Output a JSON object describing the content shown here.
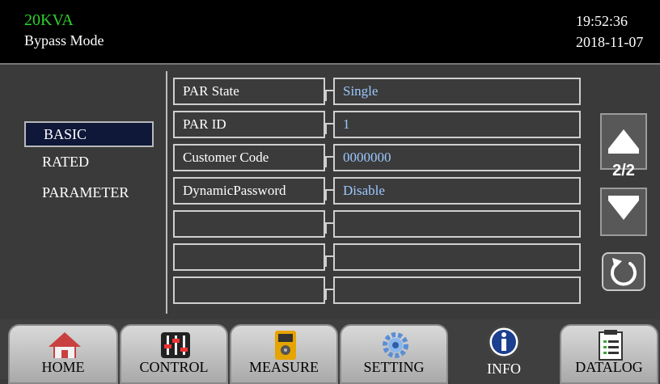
{
  "header": {
    "model": "20KVA",
    "mode": "Bypass Mode",
    "time": "19:52:36",
    "date": "2018-11-07"
  },
  "sidebar": {
    "items": [
      {
        "label": "BASIC",
        "active": true
      },
      {
        "label": "RATED",
        "active": false
      },
      {
        "label": "PARAMETER",
        "active": false
      }
    ]
  },
  "table": {
    "rows": [
      {
        "label": "PAR State",
        "value": "Single"
      },
      {
        "label": "PAR ID",
        "value": "1"
      },
      {
        "label": "Customer Code",
        "value": "0000000"
      },
      {
        "label": "DynamicPassword",
        "value": "Disable"
      },
      {
        "label": "",
        "value": ""
      },
      {
        "label": "",
        "value": ""
      },
      {
        "label": "",
        "value": ""
      }
    ]
  },
  "pager": {
    "indicator": "2/2",
    "up_icon": "up-arrow-icon",
    "down_icon": "down-arrow-icon",
    "refresh_icon": "refresh-icon"
  },
  "bottom_nav": {
    "tabs": [
      {
        "label": "HOME",
        "icon": "house-icon",
        "active": false
      },
      {
        "label": "CONTROL",
        "icon": "sliders-icon",
        "active": false
      },
      {
        "label": "MEASURE",
        "icon": "meter-icon",
        "active": false
      },
      {
        "label": "SETTING",
        "icon": "gear-icon",
        "active": false
      },
      {
        "label": "INFO",
        "icon": "info-icon",
        "active": true
      },
      {
        "label": "DATALOG",
        "icon": "clipboard-icon",
        "active": false
      }
    ]
  },
  "colors": {
    "model_text": "#2cd12c",
    "value_text": "#9cc8ff",
    "background": "#3a3a3a",
    "header_bg": "#000000",
    "active_sidebar_bg": "#0f1838"
  }
}
